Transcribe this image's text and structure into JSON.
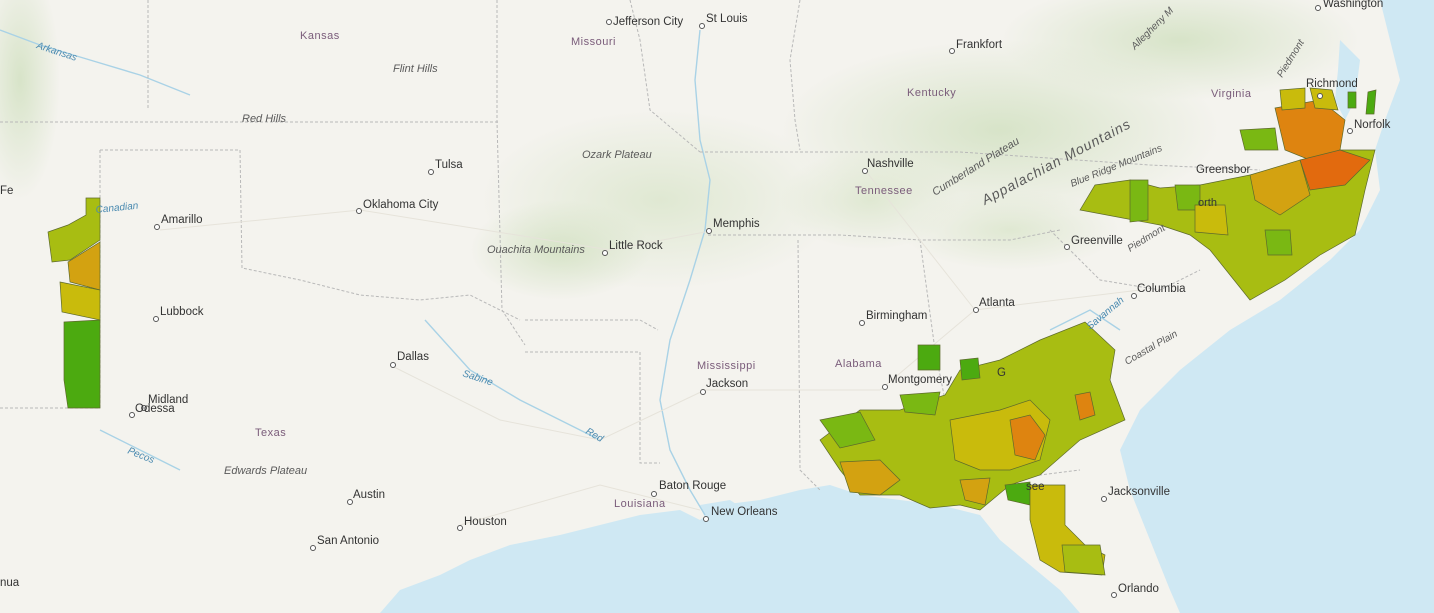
{
  "map": {
    "colors": {
      "land": "#f4f3ee",
      "water": "#cfe8f3",
      "state_border": "#b7b7b7",
      "county_stroke": "#5d6a2c",
      "city_text": "#333333",
      "region_text": "#7a5c7a",
      "feature_text": "#5a5a5a",
      "river_text": "#4a8ab0"
    },
    "choropleth_ramp": [
      "#4caa10",
      "#7ab813",
      "#a8bd12",
      "#c9bb0c",
      "#d3a211",
      "#de8410",
      "#e26a0e"
    ],
    "cities": [
      "Jefferson City",
      "St Louis",
      "Washington",
      "Frankfort",
      "Richmond",
      "Norfolk",
      "Nashville",
      "Greensbor",
      "Tulsa",
      "Oklahoma City",
      "Amarillo",
      "Memphis",
      "Little Rock",
      "Greenville",
      "Atlanta",
      "Columbia",
      "Birmingham",
      "Lubbock",
      "Dallas",
      "Montgomery",
      "Jackson",
      "Midland",
      "Odessa",
      "Austin",
      "Baton Rouge",
      "New Orleans",
      "Houston",
      "San Antonio",
      "Jacksonville",
      "Orlando",
      "Fe",
      "nua",
      "see",
      "G"
    ],
    "states": [
      "Kansas",
      "Missouri",
      "Kentucky",
      "Virginia",
      "Tennessee",
      "Mississippi",
      "Alabama",
      "Texas",
      "Louisiana"
    ],
    "features": [
      "Flint Hills",
      "Red Hills",
      "Ozark Plateau",
      "Ouachita Mountains",
      "Cumberland Plateau",
      "Appalachian Mountains",
      "Blue Ridge Mountains",
      "Allegheny M",
      "Piedmont",
      "Coastal Plain",
      "Edwards Plateau",
      "orth"
    ],
    "rivers": [
      "Arkansas",
      "Sabine",
      "Red",
      "Pecos",
      "Canadian",
      "Savannah",
      "Mississippi"
    ]
  }
}
